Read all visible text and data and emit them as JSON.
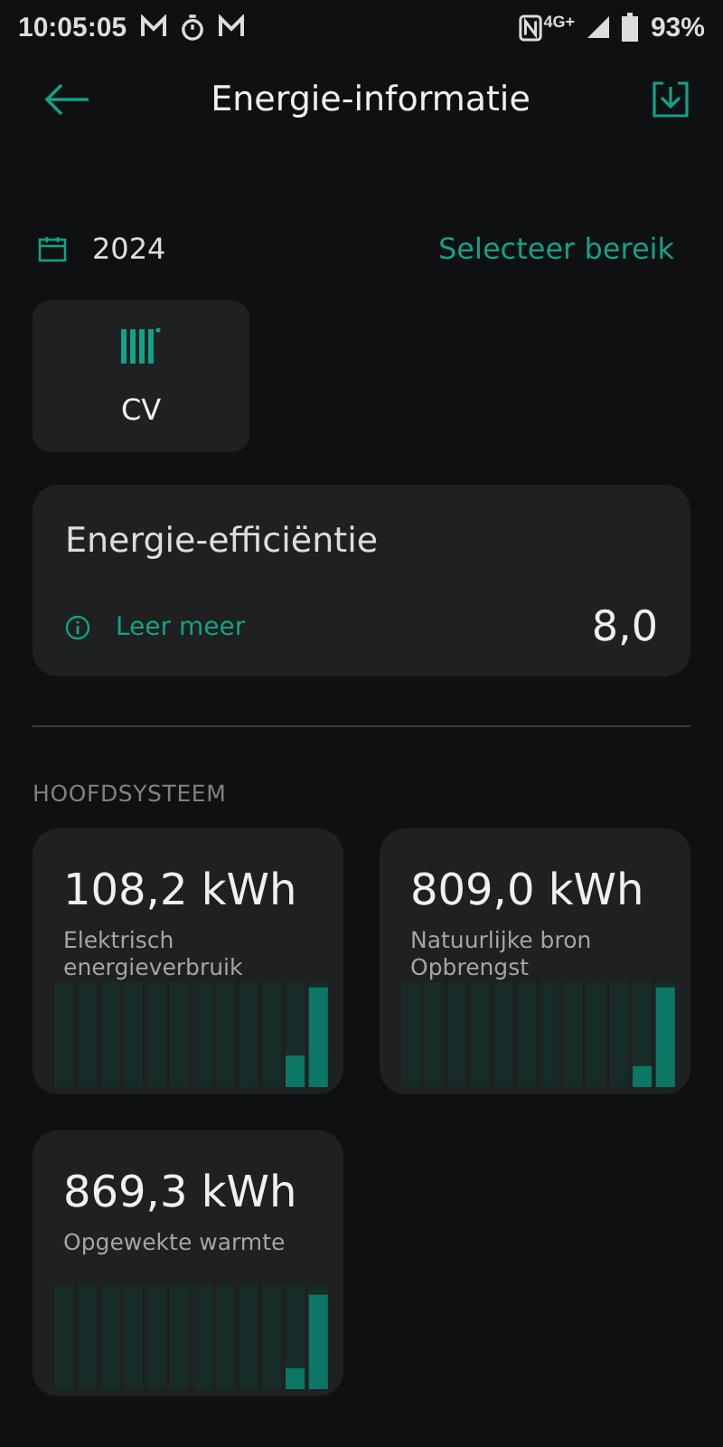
{
  "status_bar": {
    "time": "10:05:05",
    "network": "4G+",
    "battery": "93%"
  },
  "header": {
    "title": "Energie-informatie"
  },
  "period": {
    "year": "2024",
    "range_link": "Selecteer bereik"
  },
  "systems": [
    {
      "label": "CV"
    }
  ],
  "efficiency": {
    "title": "Energie-efficiëntie",
    "link": "Leer meer",
    "value": "8,0"
  },
  "section_title": "HOOFDSYSTEEM",
  "tiles": [
    {
      "value": "108,2 kWh",
      "label": "Elektrisch energieverbruik"
    },
    {
      "value": "809,0 kWh",
      "label": "Natuurlijke bron Opbrengst"
    },
    {
      "value": "869,3 kWh",
      "label": "Opgewekte warmte"
    }
  ]
}
